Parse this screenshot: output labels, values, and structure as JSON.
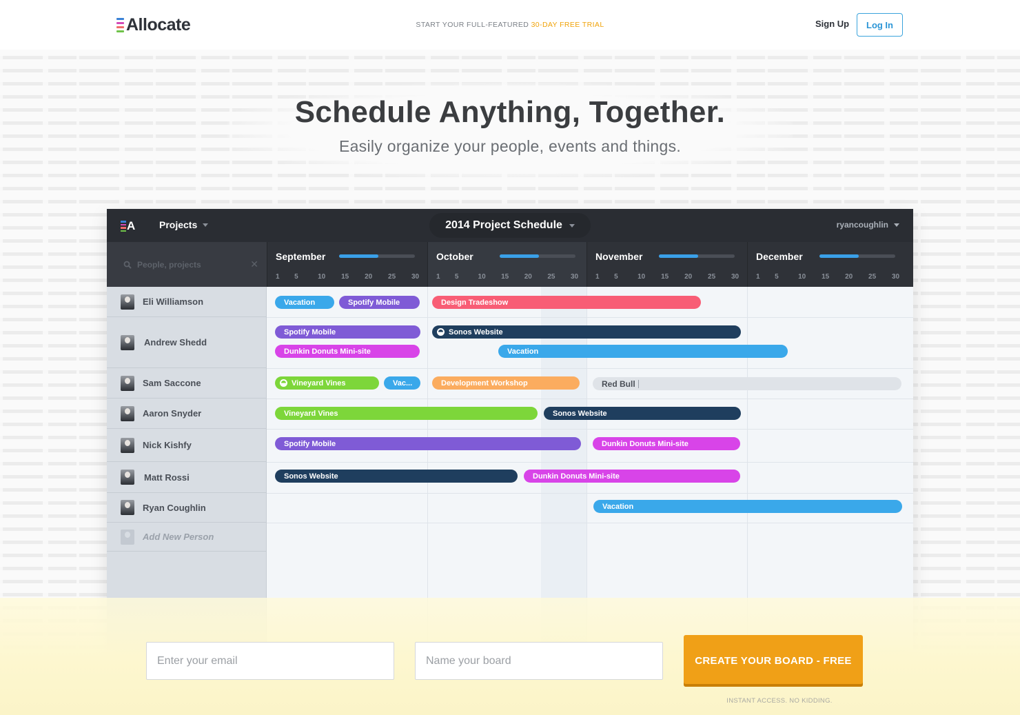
{
  "nav": {
    "logo_text": "Allocate",
    "trial_prefix": "START YOUR FULL-FEATURED ",
    "trial_highlight": "30-DAY FREE TRIAL",
    "signup_label": "Sign Up",
    "login_label": "Log In"
  },
  "hero": {
    "title": "Schedule Anything, Together.",
    "subtitle": "Easily organize your people, events and things."
  },
  "app": {
    "logo_letter": "A",
    "projects_label": "Projects",
    "schedule_title": "2014 Project Schedule",
    "username": "ryancoughlin",
    "search_placeholder": "People, projects",
    "months": [
      {
        "name": "September",
        "progress": 0.52
      },
      {
        "name": "October",
        "progress": 0.52
      },
      {
        "name": "November",
        "progress": 0.52
      },
      {
        "name": "December",
        "progress": 0.52
      }
    ],
    "tick_labels": [
      "1",
      "5",
      "10",
      "15",
      "20",
      "25",
      "30"
    ],
    "people": [
      {
        "name": "Eli Williamson"
      },
      {
        "name": "Andrew Shedd"
      },
      {
        "name": "Sam Saccone"
      },
      {
        "name": "Aaron Snyder"
      },
      {
        "name": "Nick Kishfy"
      },
      {
        "name": "Matt Rossi"
      },
      {
        "name": "Ryan Coughlin"
      }
    ],
    "add_person_label": "Add New Person",
    "bars": {
      "vacation": "Vacation",
      "spotify": "Spotify Mobile",
      "tradeshow": "Design Tradeshow",
      "sonos": "Sonos Website",
      "dunkin": "Dunkin Donuts Mini-site",
      "vineyard": "Vineyard Vines",
      "vac_short": "Vac...",
      "workshop": "Development Workshop",
      "redbull": "Red Bull"
    }
  },
  "colors": {
    "blue": "#3aa8ea",
    "purple": "#7f5bd6",
    "red": "#f85d75",
    "navy": "#1f3e5e",
    "magenta": "#d844e8",
    "green": "#7dd63a",
    "orange": "#fbac5f",
    "accent": "#f0a017"
  },
  "signup": {
    "email_placeholder": "Enter your email",
    "board_placeholder": "Name your board",
    "cta_label": "CREATE YOUR BOARD - FREE",
    "note": "INSTANT ACCESS. NO KIDDING."
  }
}
